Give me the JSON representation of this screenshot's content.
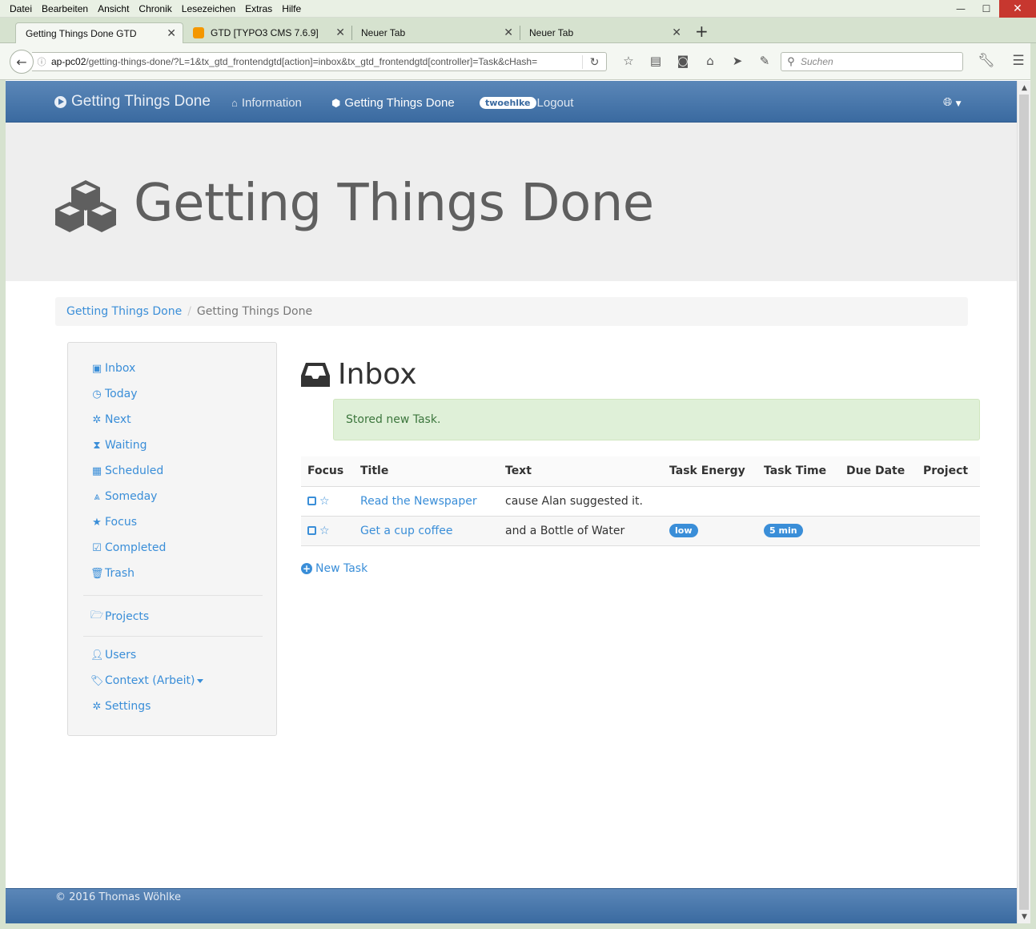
{
  "menubar": {
    "items": [
      "Datei",
      "Bearbeiten",
      "Ansicht",
      "Chronik",
      "Lesezeichen",
      "Extras",
      "Hilfe"
    ]
  },
  "tabs": [
    {
      "label": "Getting Things Done GTD",
      "active": true
    },
    {
      "label": "GTD [TYPO3 CMS 7.6.9]",
      "active": false
    },
    {
      "label": "Neuer Tab",
      "active": false
    },
    {
      "label": "Neuer Tab",
      "active": false
    }
  ],
  "urlbar": {
    "host": "ap-pc02",
    "path": "/getting-things-done/?L=1&tx_gtd_frontendgtd[action]=inbox&tx_gtd_frontendgtd[controller]=Task&cHash="
  },
  "search": {
    "placeholder": "Suchen"
  },
  "site_nav": {
    "brand": "Getting Things Done",
    "links": [
      {
        "label": "Information",
        "icon": "home-icon"
      },
      {
        "label": "Getting Things Done",
        "icon": "cubes-icon"
      }
    ],
    "user": "twoehlke",
    "logout": "Logout"
  },
  "jumbotron": {
    "title": "Getting Things Done"
  },
  "breadcrumb": {
    "items": [
      "Getting Things Done",
      "Getting Things Done"
    ]
  },
  "sidebar": {
    "items": [
      {
        "label": "Inbox",
        "icon": "inbox-icon"
      },
      {
        "label": "Today",
        "icon": "clock-icon"
      },
      {
        "label": "Next",
        "icon": "gear-icon"
      },
      {
        "label": "Waiting",
        "icon": "hourglass-icon"
      },
      {
        "label": "Scheduled",
        "icon": "calendar-icon"
      },
      {
        "label": "Someday",
        "icon": "road-icon"
      },
      {
        "label": "Focus",
        "icon": "star-icon"
      },
      {
        "label": "Completed",
        "icon": "check-square-icon"
      },
      {
        "label": "Trash",
        "icon": "trash-icon"
      },
      {
        "label": "Projects",
        "icon": "folder-open-icon"
      },
      {
        "label": "Users",
        "icon": "user-icon"
      },
      {
        "label": "Context (Arbeit)",
        "icon": "tags-icon"
      },
      {
        "label": "Settings",
        "icon": "gear-icon"
      }
    ]
  },
  "main": {
    "heading": "Inbox",
    "alert": "Stored new Task.",
    "table": {
      "headers": [
        "Focus",
        "Title",
        "Text",
        "Task Energy",
        "Task Time",
        "Due Date",
        "Project"
      ],
      "rows": [
        {
          "title": "Read the Newspaper",
          "text": "cause Alan suggested it.",
          "energy": "",
          "time": "",
          "due": "",
          "project": ""
        },
        {
          "title": "Get a cup coffee",
          "text": "and a Bottle of Water",
          "energy": "low",
          "time": "5 min",
          "due": "",
          "project": ""
        }
      ]
    },
    "new_task": "New Task"
  },
  "footer": {
    "text": "© 2016 Thomas Wöhlke"
  },
  "colors": {
    "navbar": "#3a6aa0",
    "link": "#3a8ed8",
    "alert_bg": "#dff0d8",
    "alert_text": "#3c763d",
    "jumbotron_bg": "#eeeeee"
  }
}
